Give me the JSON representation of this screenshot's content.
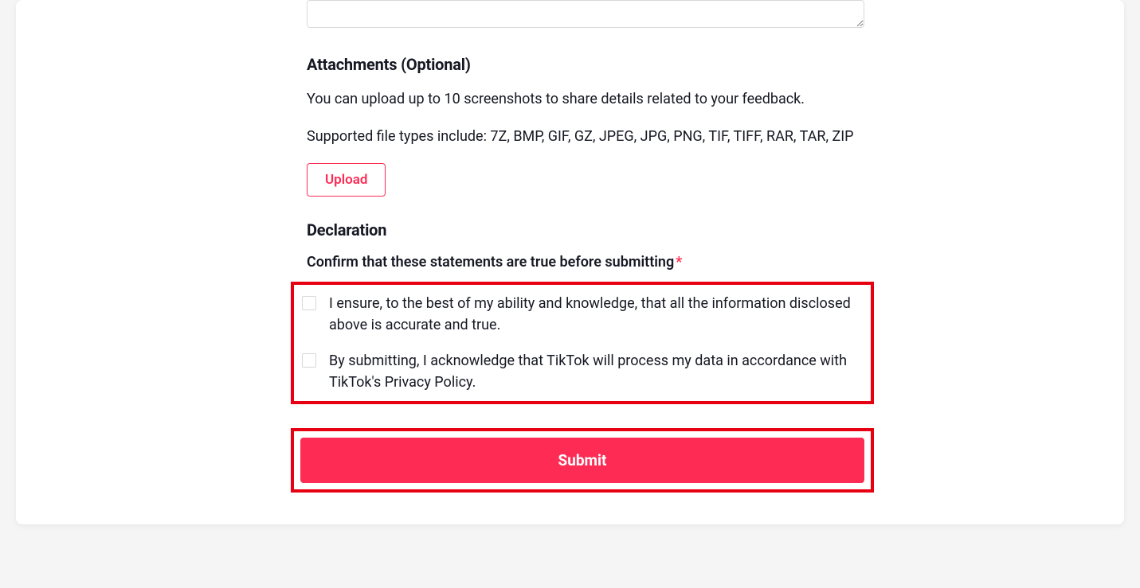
{
  "attachments": {
    "heading": "Attachments (Optional)",
    "help1": "You can upload up to 10 screenshots to share details related to your feedback.",
    "help2": "Supported file types include: 7Z, BMP, GIF, GZ, JPEG, JPG, PNG, TIF, TIFF, RAR, TAR, ZIP",
    "upload_label": "Upload"
  },
  "declaration": {
    "heading": "Declaration",
    "confirm_label": "Confirm that these statements are true before submitting",
    "required_marker": "*",
    "items": [
      "I ensure, to the best of my ability and knowledge, that all the information disclosed above is accurate and true.",
      "By submitting, I acknowledge that TikTok will process my data in accordance with TikTok's Privacy Policy."
    ]
  },
  "submit_label": "Submit"
}
